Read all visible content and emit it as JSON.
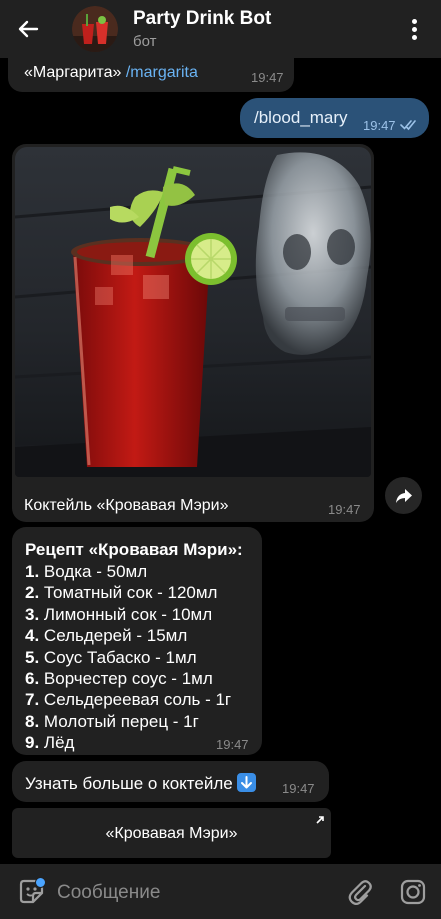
{
  "header": {
    "title": "Party Drink Bot",
    "subtitle": "бот"
  },
  "messages": {
    "prev_text": "«Маргарита» ",
    "prev_link": "/margarita",
    "prev_time": "19:47",
    "outgoing_text": "/blood_mary",
    "outgoing_time": "19:47",
    "photo_caption": "Коктейль «Кровавая Мэри»",
    "photo_time": "19:47",
    "recipe_title": "Рецепт «Кровавая Мэри»:",
    "recipe_items": [
      {
        "num": "1.",
        "text": " Водка - 50мл"
      },
      {
        "num": "2.",
        "text": " Томатный сок - 120мл"
      },
      {
        "num": "3.",
        "text": " Лимонный сок - 10мл"
      },
      {
        "num": "4.",
        "text": " Сельдерей - 15мл"
      },
      {
        "num": "5.",
        "text": " Соус Табаско - 1мл"
      },
      {
        "num": "6.",
        "text": " Ворчестер соус - 1мл"
      },
      {
        "num": "7.",
        "text": " Сельдереевая соль - 1г"
      },
      {
        "num": "8.",
        "text": " Молотый перец - 1г"
      },
      {
        "num": "9.",
        "text": " Лёд"
      }
    ],
    "recipe_time": "19:47",
    "more_text": "Узнать больше о коктейле",
    "more_time": "19:47"
  },
  "inline_button": {
    "label": "«Кровавая Мэри»"
  },
  "composer": {
    "placeholder": "Сообщение"
  },
  "colors": {
    "background": "#000000",
    "bubble_incoming": "#212121",
    "bubble_outgoing": "#2b5278",
    "link": "#6ab3f3",
    "accent": "#4aa4ff"
  },
  "icons": [
    "back-arrow-icon",
    "more-vertical-icon",
    "share-icon",
    "down-arrow-emoji",
    "external-link-icon",
    "sticker-icon",
    "attach-icon",
    "camera-icon"
  ]
}
